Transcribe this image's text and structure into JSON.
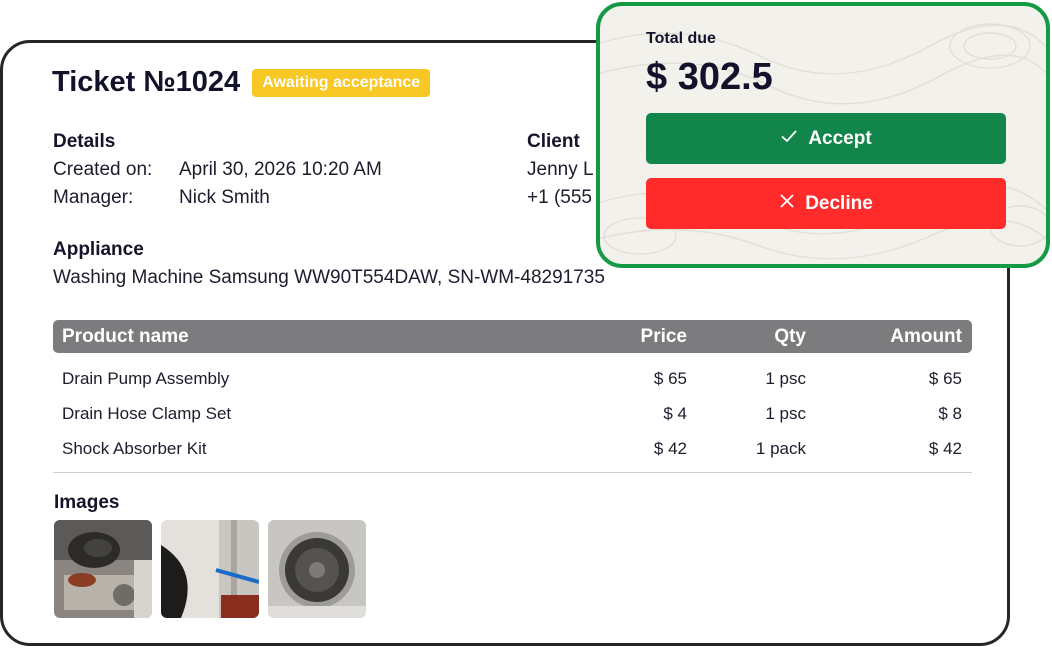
{
  "ticket": {
    "title": "Ticket №1024",
    "status": "Awaiting acceptance"
  },
  "details": {
    "heading": "Details",
    "created_label": "Created on:",
    "created_value": "April 30, 2026 10:20 AM",
    "manager_label": "Manager:",
    "manager_value": "Nick Smith"
  },
  "client": {
    "heading": "Client",
    "name": "Jenny L",
    "phone": "+1 (555"
  },
  "appliance": {
    "heading": "Appliance",
    "value": "Washing Machine Samsung WW90T554DAW, SN-WM-48291735"
  },
  "table": {
    "headers": {
      "product": "Product name",
      "price": "Price",
      "qty": "Qty",
      "amount": "Amount"
    },
    "rows": [
      {
        "product": "Drain Pump Assembly",
        "price": "$ 65",
        "qty": "1 psc",
        "amount": "$ 65"
      },
      {
        "product": "Drain Hose Clamp Set",
        "price": "$ 4",
        "qty": "1 psc",
        "amount": "$ 8"
      },
      {
        "product": "Shock Absorber Kit",
        "price": "$ 42",
        "qty": "1 pack",
        "amount": "$ 42"
      }
    ]
  },
  "images": {
    "heading": "Images"
  },
  "payment": {
    "label": "Total due",
    "total": "$ 302.5",
    "accept_label": "Accept",
    "decline_label": "Decline"
  },
  "icons": {
    "accept": "check-icon",
    "decline": "close-icon"
  },
  "colors": {
    "status_badge": "#f7c724",
    "accept": "#12854a",
    "decline": "#ff2b2b",
    "panel_border": "#139a43",
    "table_header": "#7c7c7e"
  }
}
